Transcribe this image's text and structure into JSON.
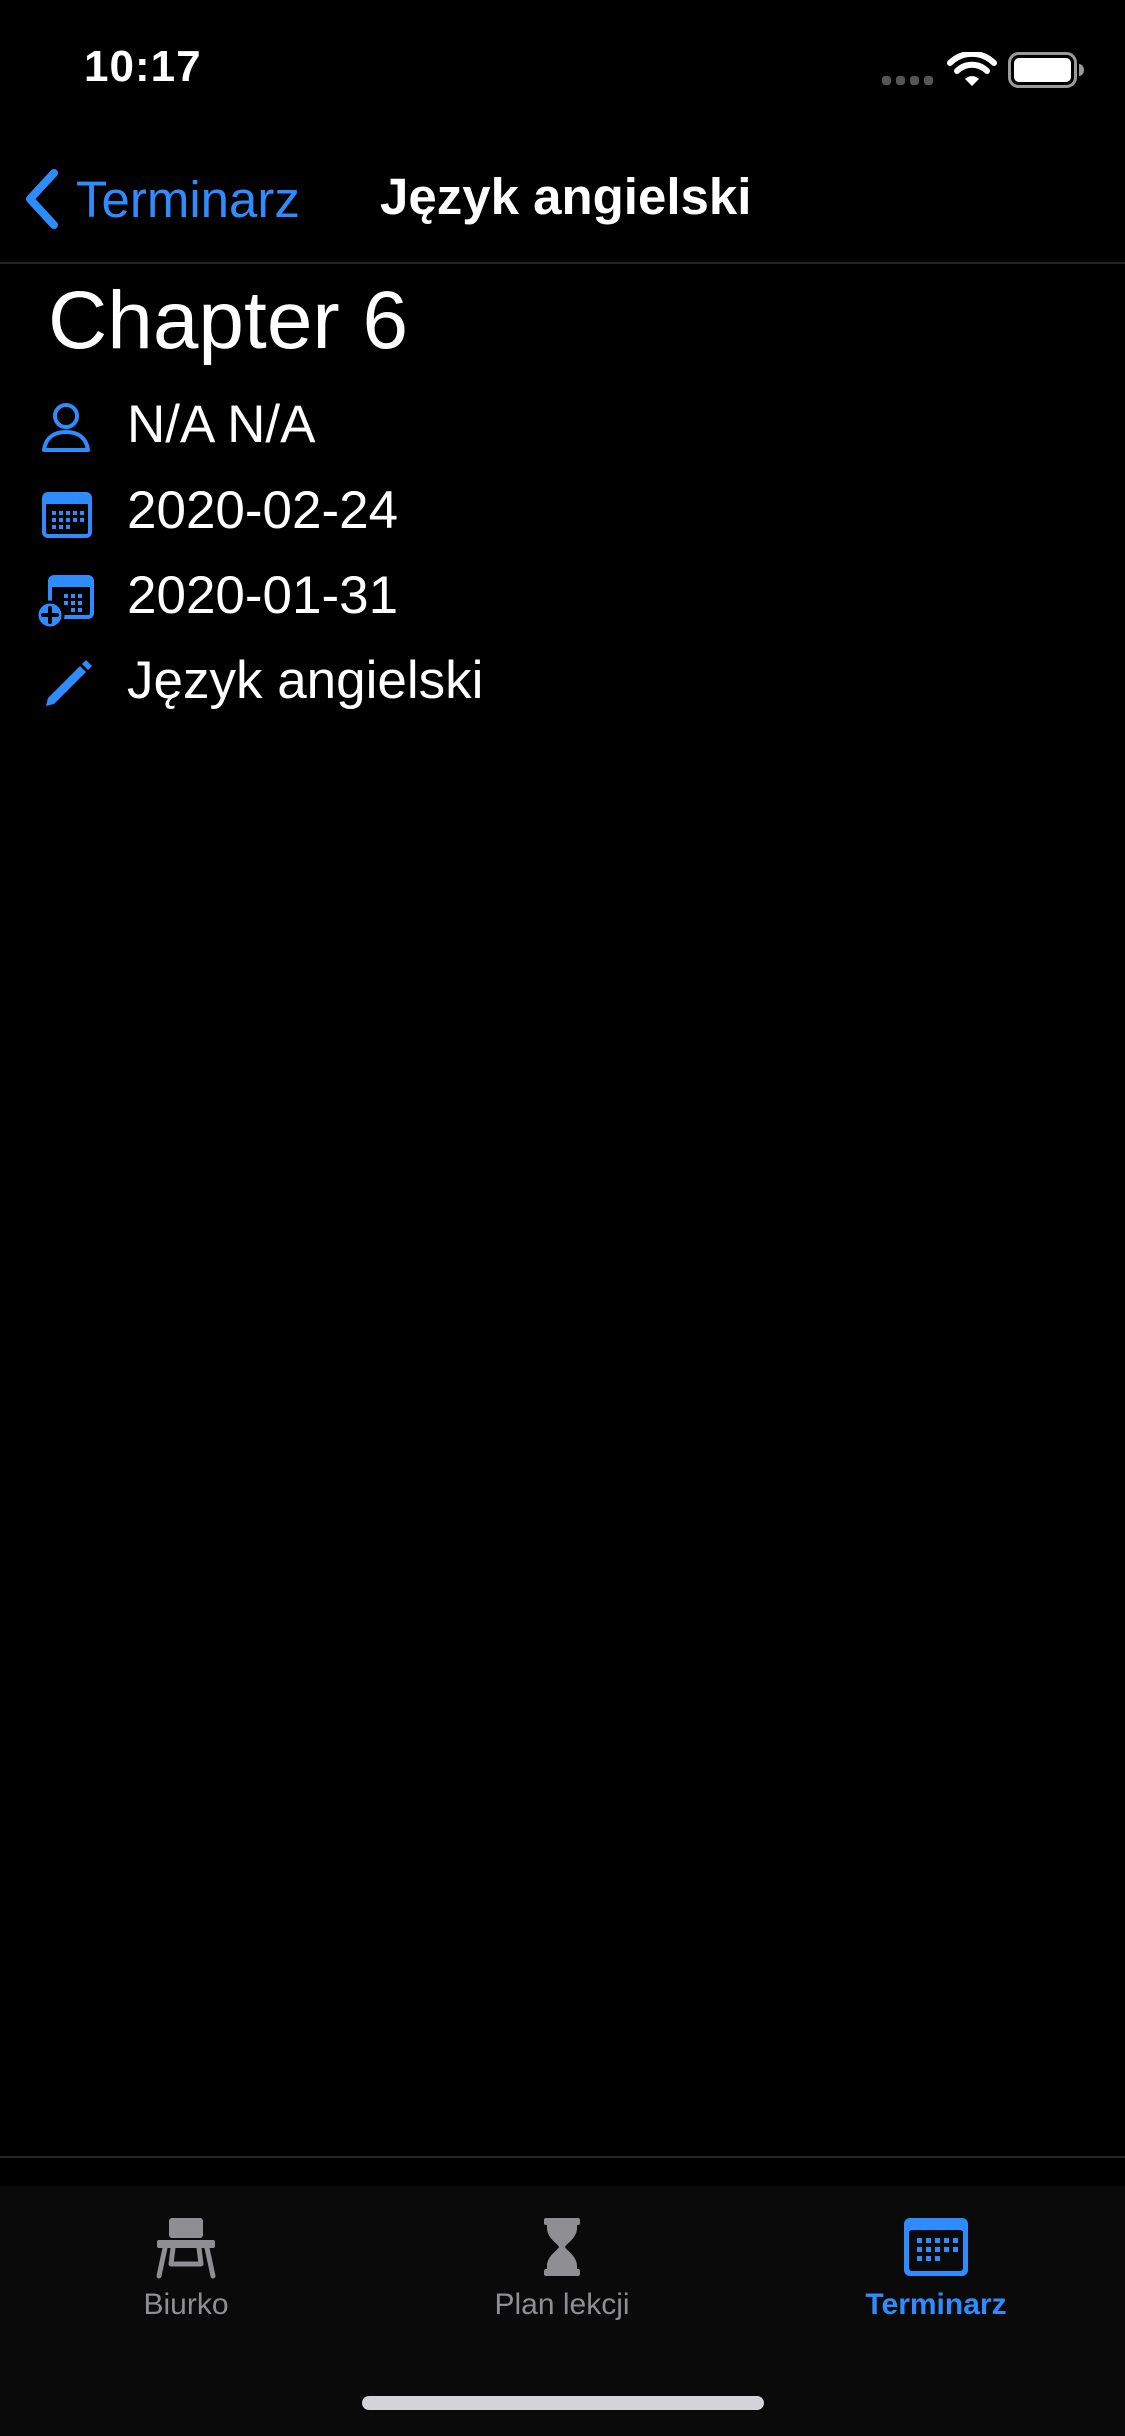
{
  "status_bar": {
    "time": "10:17"
  },
  "nav": {
    "back_label": "Terminarz",
    "title": "Język angielski"
  },
  "detail": {
    "title": "Chapter 6",
    "rows": [
      {
        "icon": "person-icon",
        "text": "N/A N/A"
      },
      {
        "icon": "calendar-icon",
        "text": "2020-02-24"
      },
      {
        "icon": "calendar-add-icon",
        "text": "2020-01-31"
      },
      {
        "icon": "pencil-icon",
        "text": "Język angielski"
      }
    ]
  },
  "tab_bar": {
    "items": [
      {
        "label": "Biurko",
        "icon": "desk-icon",
        "active": false
      },
      {
        "label": "Plan lekcji",
        "icon": "hourglass-icon",
        "active": false
      },
      {
        "label": "Terminarz",
        "icon": "calendar-icon",
        "active": true
      }
    ]
  },
  "colors": {
    "accent": "#2f8cff",
    "background": "#000000",
    "inactive": "#8e8e93"
  }
}
